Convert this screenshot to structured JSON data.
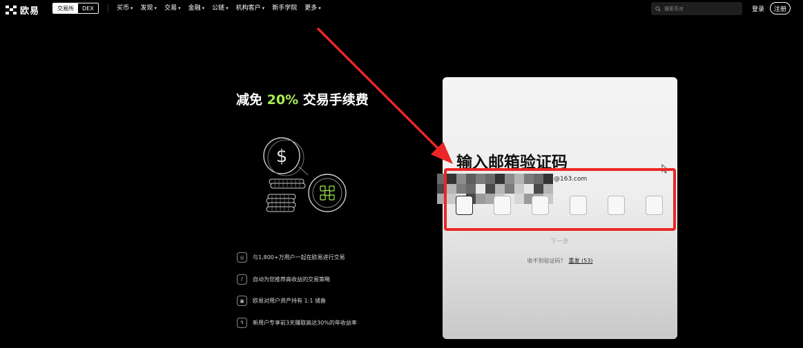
{
  "nav": {
    "brand": "欧易",
    "mode_tabs": [
      "交易所",
      "DEX"
    ],
    "menu": [
      "买币",
      "发现",
      "交易",
      "金融",
      "公链",
      "机构客户",
      "新手学院",
      "更多"
    ],
    "menu_has_caret": [
      true,
      true,
      true,
      true,
      true,
      true,
      false,
      true
    ],
    "search_placeholder": "搜索币对",
    "login": "登录",
    "signup": "注册"
  },
  "promo": {
    "headline_pre": "减免 ",
    "headline_highlight": "20%",
    "headline_post": " 交易手续费",
    "highlight_color": "#a8ef4f",
    "features": [
      {
        "icon": "users-icon",
        "text": "与1,800+万用户一起在欧易进行交易"
      },
      {
        "icon": "strategy-icon",
        "text": "自动为您推荐高收益的交易策略"
      },
      {
        "icon": "wallet-icon",
        "text": "欧易对用户资产持有 1:1 储备"
      },
      {
        "icon": "chart-icon",
        "text": "新用户专享前3天赚取高达30%的年收益率"
      }
    ]
  },
  "modal": {
    "title": "输入邮箱验证码",
    "email_suffix": "@163.com",
    "code_boxes": 6,
    "next_button": "下一步",
    "resend_prompt": "收不到验证码？",
    "resend_link": "重发 (53)"
  },
  "colors": {
    "annotation_red": "#ec2626",
    "background": "#000000"
  }
}
